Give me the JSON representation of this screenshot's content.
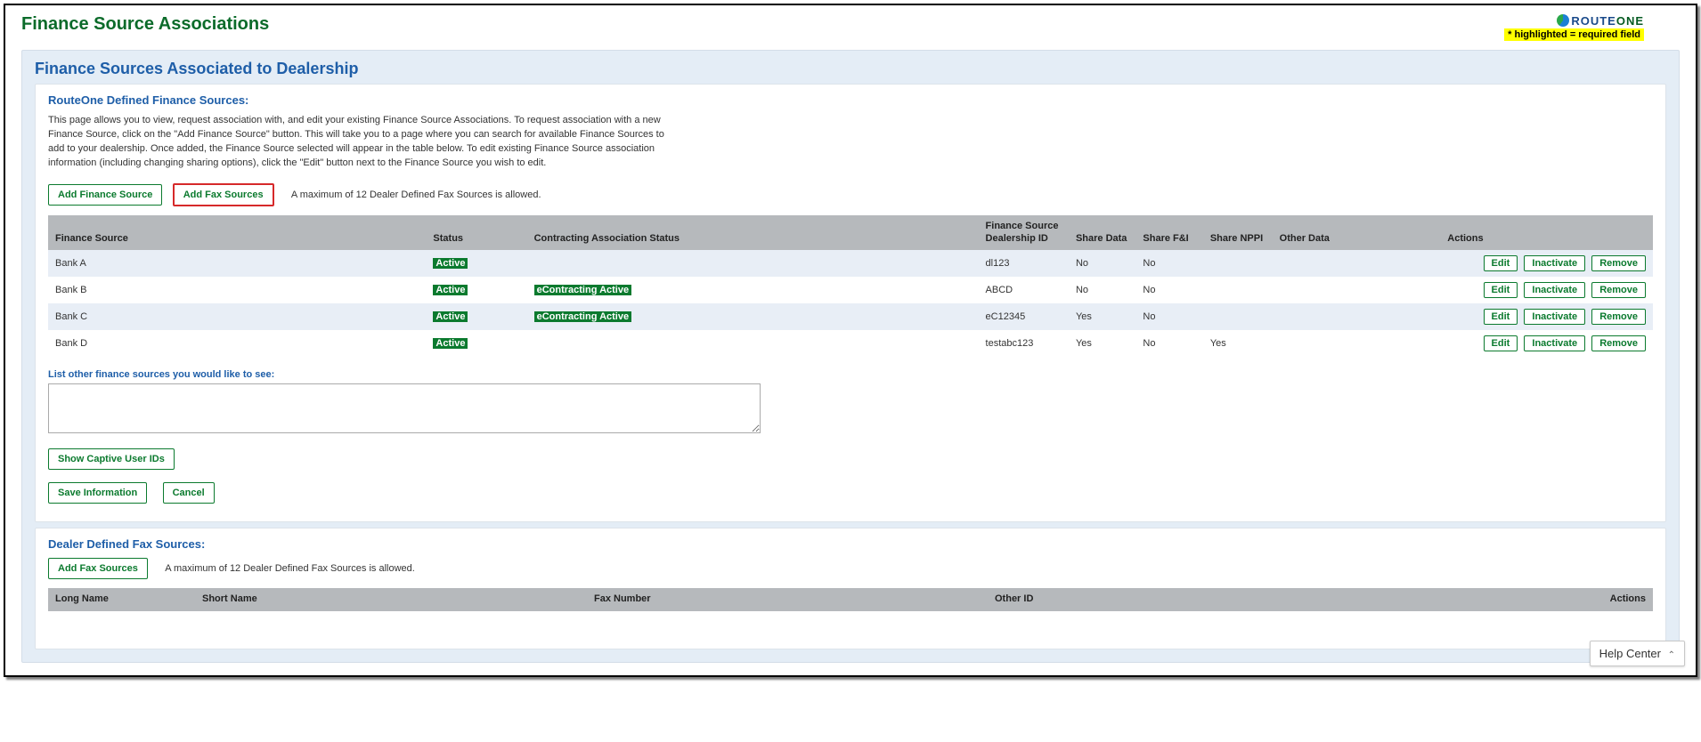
{
  "header": {
    "page_title": "Finance Source Associations",
    "logo_route": "ROUTE",
    "logo_one": "ONE",
    "required_note": "* highlighted = required field"
  },
  "panel": {
    "title": "Finance Sources Associated to Dealership"
  },
  "section1": {
    "title": "RouteOne Defined Finance Sources:",
    "desc": "This page allows you to view, request association with, and edit your existing Finance Source Associations. To request association with a new Finance Source, click on the \"Add Finance Source\" button. This will take you to a page where you can search for available Finance Sources to add to your dealership. Once added, the Finance Source selected will appear in the table below. To edit existing Finance Source association information (including changing sharing options), click the \"Edit\" button next to the Finance Source you wish to edit.",
    "add_fs_btn": "Add Finance Source",
    "add_fax_btn": "Add Fax Sources",
    "fax_note": "A maximum of 12 Dealer Defined Fax Sources is allowed.",
    "columns": {
      "fs": "Finance Source",
      "status": "Status",
      "cas": "Contracting Association Status",
      "fsid": "Finance Source Dealership ID",
      "share_data": "Share Data",
      "share_fi": "Share F&I",
      "share_nppi": "Share NPPI",
      "other_data": "Other Data",
      "actions": "Actions"
    },
    "rows": [
      {
        "fs": "Bank A",
        "status": "Active",
        "cas": "",
        "fsid": "dl123",
        "share_data": "No",
        "share_fi": "No",
        "share_nppi": "",
        "other_data": ""
      },
      {
        "fs": "Bank B",
        "status": "Active",
        "cas": "eContracting Active",
        "fsid": "ABCD",
        "share_data": "No",
        "share_fi": "No",
        "share_nppi": "",
        "other_data": ""
      },
      {
        "fs": "Bank C",
        "status": "Active",
        "cas": "eContracting Active",
        "fsid": "eC12345",
        "share_data": "Yes",
        "share_fi": "No",
        "share_nppi": "",
        "other_data": ""
      },
      {
        "fs": "Bank D",
        "status": "Active",
        "cas": "",
        "fsid": "testabc123",
        "share_data": "Yes",
        "share_fi": "No",
        "share_nppi": "Yes",
        "other_data": ""
      }
    ],
    "action_labels": {
      "edit": "Edit",
      "inactivate": "Inactivate",
      "remove": "Remove"
    },
    "list_label": "List other finance sources you would like to see:",
    "show_captive_btn": "Show Captive User IDs",
    "save_btn": "Save Information",
    "cancel_btn": "Cancel"
  },
  "section2": {
    "title": "Dealer Defined Fax Sources:",
    "add_fax_btn": "Add Fax Sources",
    "fax_note": "A maximum of 12 Dealer Defined Fax Sources is allowed.",
    "columns": {
      "long_name": "Long Name",
      "short_name": "Short Name",
      "fax_number": "Fax Number",
      "other_id": "Other ID",
      "actions": "Actions"
    }
  },
  "help_center": {
    "label": "Help Center",
    "chev": "⌃"
  }
}
